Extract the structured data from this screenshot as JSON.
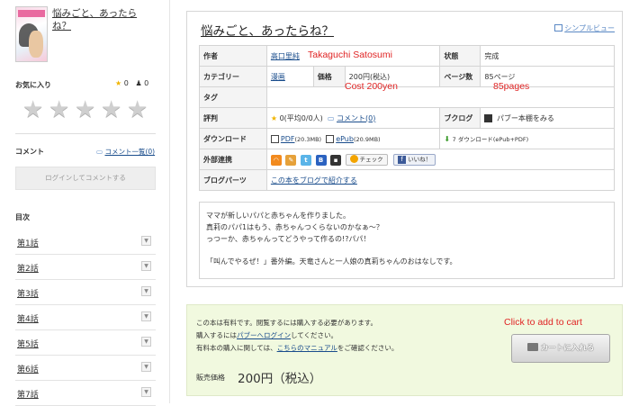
{
  "sidebar": {
    "book_title": "悩みごと、あったらね？",
    "favorites_label": "お気に入り",
    "favorites_count": "0",
    "favorites_user_count": "0",
    "comment_label": "コメント",
    "comment_list_link": "コメント一覧(0)",
    "login_prompt": "ログインしてコメントする",
    "toc_label": "目次",
    "toc_items": [
      "第1話",
      "第2話",
      "第3話",
      "第4話",
      "第5話",
      "第6話",
      "第7話"
    ]
  },
  "book": {
    "title": "悩みごと、あったらね？",
    "simple_view": "シンプルビュー",
    "author_label": "作者",
    "author_name": "高口里純",
    "status_label": "状態",
    "status_value": "完成",
    "category_label": "カテゴリー",
    "category_value": "漫画",
    "price_label": "価格",
    "price_value": "200円(税込)",
    "pages_label": "ページ数",
    "pages_value": "85ページ",
    "tag_label": "タグ",
    "rating_label": "評判",
    "rating_value": "0(平均0/0人)",
    "comment_value": "コメント(0)",
    "blog_label": "ブクログ",
    "blog_value": "パブー本棚をみる",
    "download_label": "ダウンロード",
    "pdf_link": "PDF",
    "pdf_size": "(20.3MB)",
    "epub_link": "ePub",
    "epub_size": "(20.9MB)",
    "download_count": "7 ダウンロード",
    "download_format": "(ePub+PDF)",
    "external_label": "外部連携",
    "check_label": "チェック",
    "like_label": "いいね！",
    "blogparts_label": "ブログパーツ",
    "blogparts_link": "この本をブログで紹介する"
  },
  "annotations": {
    "author": "Takaguchi Satosumi",
    "cost": "Cost 200yen",
    "pages": "85pages",
    "cart": "Click to add to cart"
  },
  "description": {
    "line1": "ママが新しいパパと赤ちゃんを作りました。",
    "line2": "真莉のパパ1はもう、赤ちゃんつくらないのかなぁ～？",
    "line3": "っつーか、赤ちゃんってどうやって作るの!?パパ！",
    "line4": "「叫んでやるぜ！」番外編。天竜さんと一人娘の真莉ちゃんのおはなしです。"
  },
  "purchase": {
    "note1": "この本は有料です。閲覧するには購入する必要があります。",
    "note2_pre": "購入するには",
    "note2_link": "パブーへログイン",
    "note2_post": "してください。",
    "note3_pre": "有料本の購入に関しては、",
    "note3_link": "こちらのマニュアル",
    "note3_post": "をご確認ください。",
    "price_label": "販売価格",
    "price_value": "200円（税込）",
    "cart_button": "カートに入れる"
  },
  "colors": {
    "annotation_red": "#e02424",
    "link_blue": "#1a4d8c",
    "purchase_bg": "#f1f9df"
  }
}
